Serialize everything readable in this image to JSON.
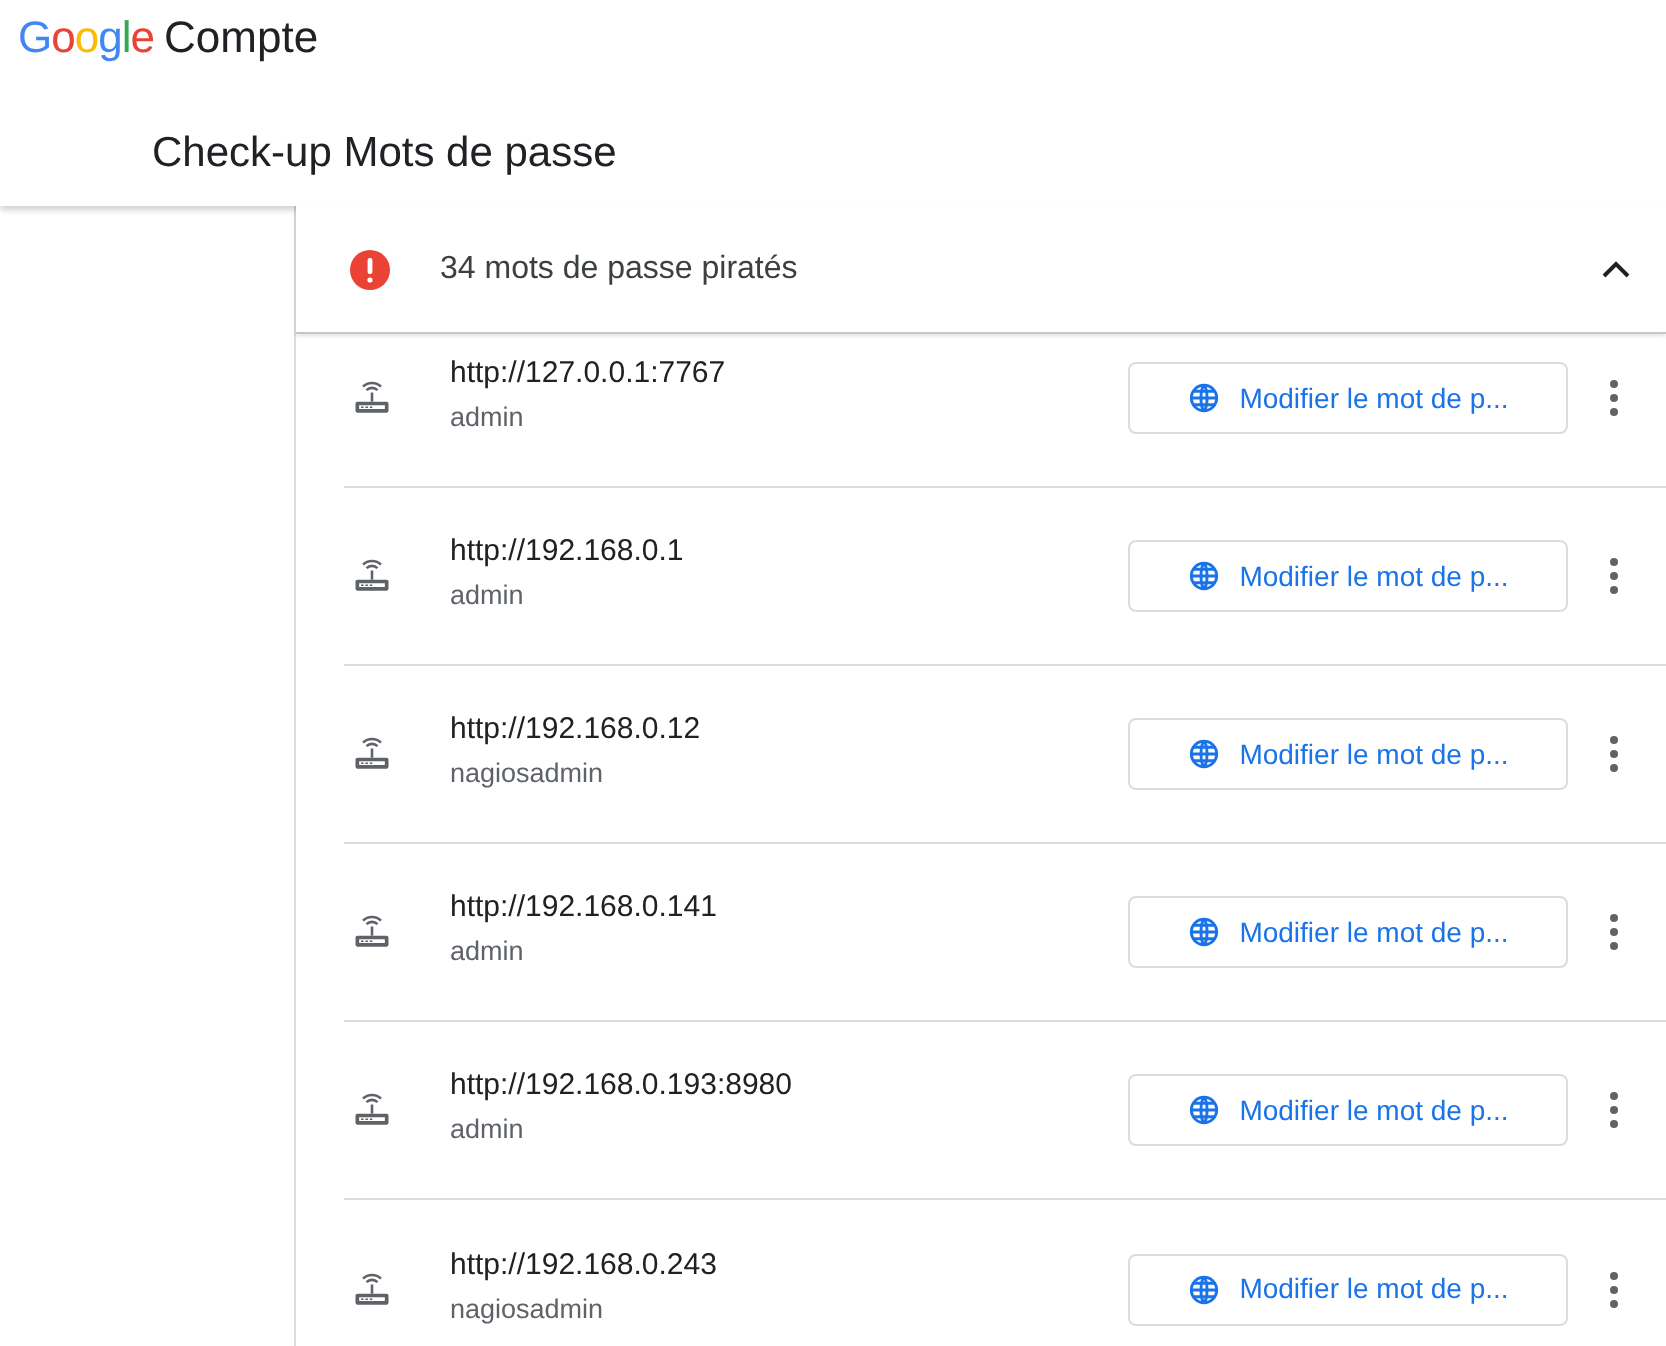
{
  "header": {
    "logo": "Google",
    "product": "Compte",
    "title": "Check-up Mots de passe"
  },
  "section": {
    "title": "34 mots de passe piratés",
    "expanded": true
  },
  "rows": [
    {
      "url": "http://127.0.0.1:7767",
      "user": "admin",
      "action": "Modifier le mot de p..."
    },
    {
      "url": "http://192.168.0.1",
      "user": "admin",
      "action": "Modifier le mot de p..."
    },
    {
      "url": "http://192.168.0.12",
      "user": "nagiosadmin",
      "action": "Modifier le mot de p..."
    },
    {
      "url": "http://192.168.0.141",
      "user": "admin",
      "action": "Modifier le mot de p..."
    },
    {
      "url": "http://192.168.0.193:8980",
      "user": "admin",
      "action": "Modifier le mot de p..."
    },
    {
      "url": "http://192.168.0.243",
      "user": "nagiosadmin",
      "action": "Modifier le mot de p..."
    }
  ]
}
